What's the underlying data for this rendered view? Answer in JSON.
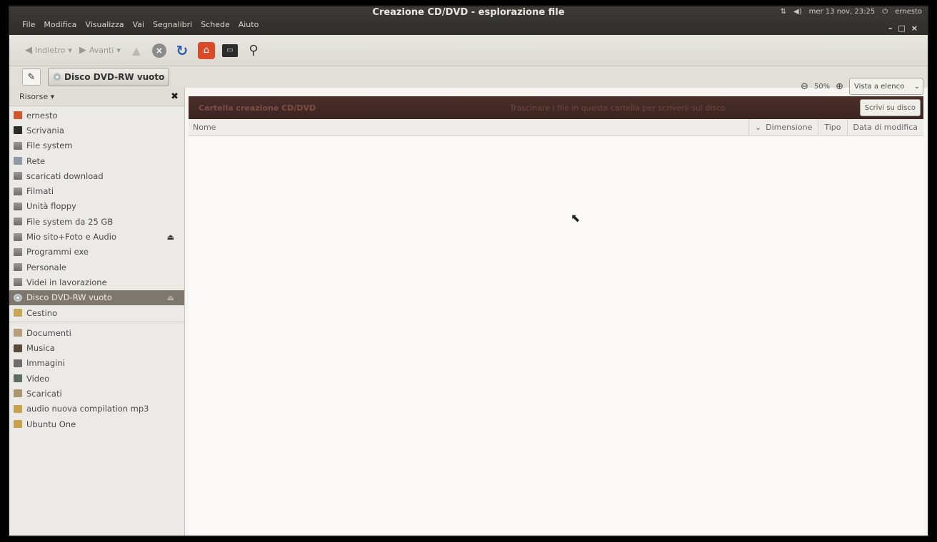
{
  "window": {
    "title": "Creazione CD/DVD - esplorazione file",
    "clock": "mer 13 nov, 23:25",
    "user": "ernesto",
    "controls": [
      "–",
      "□",
      "×"
    ]
  },
  "menubar": [
    "File",
    "Modifica",
    "Visualizza",
    "Vai",
    "Segnalibri",
    "Schede",
    "Aiuto"
  ],
  "toolbar": {
    "back_label": "Indietro",
    "forward_label": "Avanti"
  },
  "location": {
    "path_button": "Disco DVD-RW vuoto"
  },
  "sidebar": {
    "header": "Risorse",
    "devices": [
      {
        "label": "ernesto",
        "icon": "home-folder-icon"
      },
      {
        "label": "Scrivania",
        "icon": "desktop-icon"
      },
      {
        "label": "File system",
        "icon": "drive-icon"
      },
      {
        "label": "Rete",
        "icon": "network-icon"
      },
      {
        "label": "scaricati download",
        "icon": "drive-icon"
      },
      {
        "label": "Filmati",
        "icon": "drive-icon"
      },
      {
        "label": "Unità floppy",
        "icon": "drive-icon"
      },
      {
        "label": "File system da 25 GB",
        "icon": "drive-icon"
      },
      {
        "label": "Mio sito+Foto e Audio",
        "icon": "drive-icon",
        "eject": "⏏"
      },
      {
        "label": "Programmi exe",
        "icon": "drive-icon"
      },
      {
        "label": "Personale",
        "icon": "drive-icon"
      },
      {
        "label": "Videi in lavorazione",
        "icon": "drive-icon"
      },
      {
        "label": "Disco DVD-RW vuoto",
        "icon": "disc-icon",
        "eject": "⏏",
        "selected": true
      },
      {
        "label": "Cestino",
        "icon": "trash-icon"
      }
    ],
    "bookmarks": [
      {
        "label": "Documenti",
        "icon": "documents-folder-icon"
      },
      {
        "label": "Musica",
        "icon": "music-folder-icon"
      },
      {
        "label": "Immagini",
        "icon": "pictures-folder-icon"
      },
      {
        "label": "Video",
        "icon": "video-folder-icon"
      },
      {
        "label": "Scaricati",
        "icon": "downloads-folder-icon"
      },
      {
        "label": "audio nuova compilation mp3",
        "icon": "folder-icon"
      },
      {
        "label": "Ubuntu One",
        "icon": "folder-icon"
      }
    ]
  },
  "main": {
    "zoom_level": "50%",
    "view_mode": "Vista a elenco",
    "infobar_title": "Cartella creazione CD/DVD",
    "infobar_message": "Trascinare i file in questa cartella per scriverli sul disco",
    "burn_button": "Scrivi su disco",
    "columns": {
      "name": "Nome",
      "size": "Dimensione",
      "type": "Tipo",
      "modified": "Data di modifica"
    }
  },
  "colors": {
    "infobar_bg": "#3b2421",
    "selected_row_bg": "#7d776d",
    "titlebar_bg": "#3c3b37"
  }
}
